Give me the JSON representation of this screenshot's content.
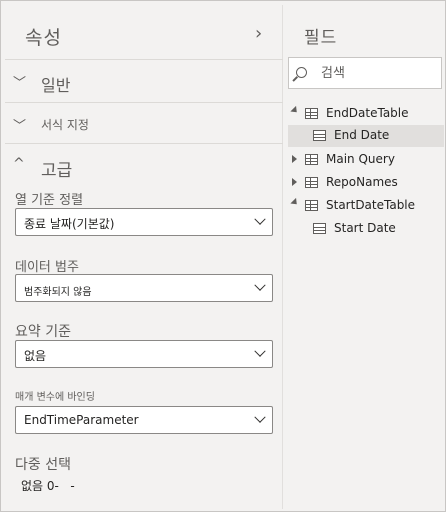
{
  "properties": {
    "title": "속성",
    "sections": {
      "general": "일반",
      "formatting": "서식 지정",
      "advanced": "고급"
    },
    "sort_by_column": {
      "label": "열 기준 정렬",
      "value": "종료 날짜(기본값)"
    },
    "data_category": {
      "label": "데이터 범주",
      "value": "범주화되지 않음"
    },
    "summarize_by": {
      "label": "요약 기준",
      "value": "없음"
    },
    "bind_to_parameter": {
      "label": "매개 변수에 바인딩",
      "value": "EndTimeParameter"
    },
    "multi_select": {
      "label": "다중 선택",
      "value": "없음 0-"
    }
  },
  "fields": {
    "title": "필드",
    "search_placeholder": "검색",
    "tree": [
      {
        "label": "EndDateTable",
        "kind": "table",
        "expanded": true
      },
      {
        "label": "End Date",
        "kind": "column",
        "selected": true
      },
      {
        "label": "Main Query",
        "kind": "table",
        "expanded": false
      },
      {
        "label": "RepoNames",
        "kind": "table",
        "expanded": false
      },
      {
        "label": "StartDateTable",
        "kind": "table",
        "expanded": true
      },
      {
        "label": "Start Date",
        "kind": "column",
        "selected": false
      }
    ]
  },
  "colors": {
    "pane_bg": "#f3f2f1",
    "selected_row": "#e1dfdd",
    "text_secondary": "#605e5c"
  }
}
